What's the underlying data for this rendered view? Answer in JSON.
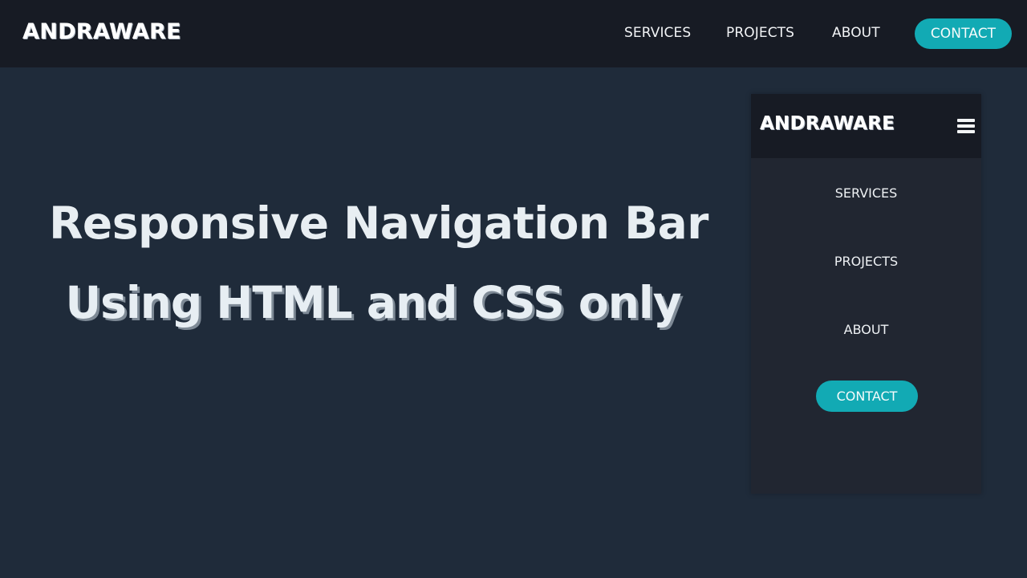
{
  "brand": {
    "name": "ANDRAWARE"
  },
  "nav": {
    "items": [
      {
        "label": "SERVICES"
      },
      {
        "label": "PROJECTS"
      },
      {
        "label": "ABOUT"
      }
    ],
    "cta": {
      "label": "CONTACT"
    }
  },
  "hero": {
    "title": "Responsive Navigation Bar",
    "subtitle": "Using HTML and CSS only"
  },
  "mobile_preview": {
    "brand": "ANDRAWARE",
    "menu_icon": "hamburger-icon",
    "items": [
      {
        "label": "SERVICES"
      },
      {
        "label": "PROJECTS"
      },
      {
        "label": "ABOUT"
      }
    ],
    "cta": {
      "label": "CONTACT"
    }
  },
  "colors": {
    "page_bg": "#1f2b3a",
    "navbar_bg": "#171b24",
    "panel_bg": "#212631",
    "accent": "#12aab4",
    "text": "#f2f4f6"
  }
}
